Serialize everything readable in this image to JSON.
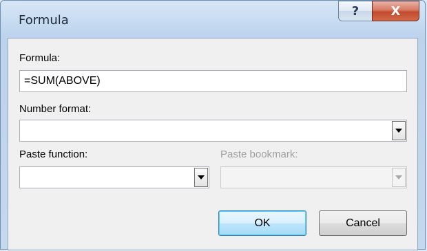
{
  "window": {
    "title": "Formula",
    "help_glyph": "?",
    "close_glyph": "X"
  },
  "formula": {
    "label": "Formula:",
    "value": "=SUM(ABOVE)"
  },
  "number_format": {
    "label": "Number format:",
    "value": ""
  },
  "paste_function": {
    "label": "Paste function:",
    "value": ""
  },
  "paste_bookmark": {
    "label": "Paste bookmark:",
    "value": "",
    "enabled": false
  },
  "buttons": {
    "ok_label": "OK",
    "cancel_label": "Cancel"
  }
}
